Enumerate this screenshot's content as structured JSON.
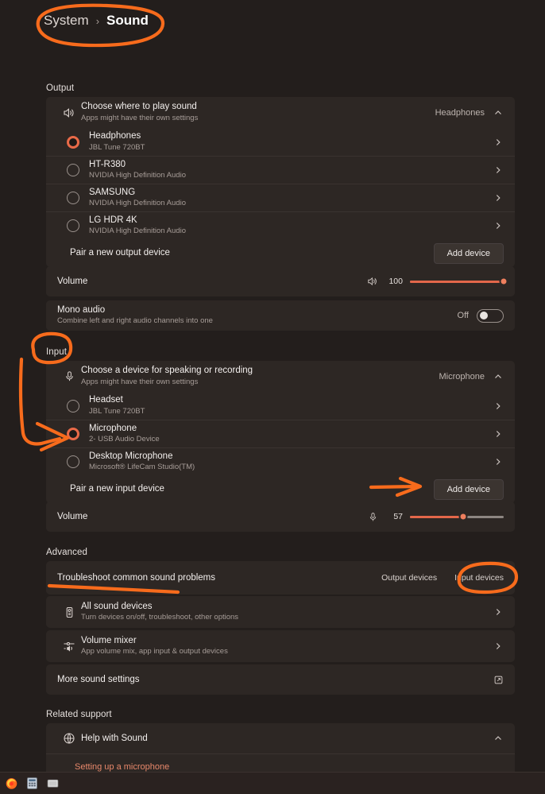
{
  "breadcrumb": {
    "parent": "System",
    "separator": "›",
    "current": "Sound"
  },
  "colors": {
    "page_background": "#231e1c",
    "card_background": "#2d2724",
    "accent": "#e3674a",
    "annotation": "#f76b1c",
    "text_primary": "#f3efed",
    "text_secondary": "#a79d98"
  },
  "output": {
    "label": "Output",
    "chooser": {
      "icon": "speaker-icon",
      "title": "Choose where to play sound",
      "subtitle": "Apps might have their own settings",
      "value": "Headphones",
      "expand_icon": "chevron-up-icon"
    },
    "devices": [
      {
        "name": "Headphones",
        "detail": "JBL Tune 720BT",
        "selected": true
      },
      {
        "name": "HT-R380",
        "detail": "NVIDIA High Definition Audio",
        "selected": false
      },
      {
        "name": "SAMSUNG",
        "detail": "NVIDIA High Definition Audio",
        "selected": false
      },
      {
        "name": "LG HDR 4K",
        "detail": "NVIDIA High Definition Audio",
        "selected": false
      }
    ],
    "pair": {
      "label": "Pair a new output device",
      "button": "Add device"
    },
    "volume": {
      "label": "Volume",
      "icon": "speaker-icon",
      "value": "100",
      "percent": 100
    },
    "mono": {
      "title": "Mono audio",
      "subtitle": "Combine left and right audio channels into one",
      "state": "Off"
    }
  },
  "input": {
    "label": "Input",
    "chooser": {
      "icon": "microphone-icon",
      "title": "Choose a device for speaking or recording",
      "subtitle": "Apps might have their own settings",
      "value": "Microphone",
      "expand_icon": "chevron-up-icon"
    },
    "devices": [
      {
        "name": "Headset",
        "detail": "JBL Tune 720BT",
        "selected": false
      },
      {
        "name": "Microphone",
        "detail": "2- USB Audio Device",
        "selected": true
      },
      {
        "name": "Desktop Microphone",
        "detail": "Microsoft® LifeCam Studio(TM)",
        "selected": false
      }
    ],
    "pair": {
      "label": "Pair a new input device",
      "button": "Add device"
    },
    "volume": {
      "label": "Volume",
      "icon": "microphone-icon",
      "value": "57",
      "percent": 57
    }
  },
  "advanced": {
    "label": "Advanced",
    "troubleshoot": {
      "title": "Troubleshoot common sound problems",
      "output_link": "Output devices",
      "input_link": "Input devices"
    },
    "all_devices": {
      "icon": "sound-devices-icon",
      "title": "All sound devices",
      "subtitle": "Turn devices on/off, troubleshoot, other options"
    },
    "volume_mixer": {
      "icon": "mixer-icon",
      "title": "Volume mixer",
      "subtitle": "App volume mix, app input & output devices"
    },
    "more": {
      "title": "More sound settings",
      "icon": "external-link-icon"
    }
  },
  "related_support": {
    "label": "Related support",
    "help": {
      "icon": "globe-help-icon",
      "title": "Help with Sound",
      "expand_icon": "chevron-up-icon"
    },
    "links": [
      "Setting up a microphone"
    ]
  },
  "taskbar": {
    "items": [
      {
        "icon": "firefox-icon"
      },
      {
        "icon": "calculator-icon"
      },
      {
        "icon": "window-icon"
      }
    ]
  },
  "annotations": [
    {
      "name": "breadcrumb-circle",
      "shape": "ellipse"
    },
    {
      "name": "input-label-circle",
      "shape": "ellipse"
    },
    {
      "name": "microphone-arrow",
      "shape": "arrow"
    },
    {
      "name": "add-device-arrow",
      "shape": "arrow"
    },
    {
      "name": "troubleshoot-underline",
      "shape": "line"
    },
    {
      "name": "input-devices-circle",
      "shape": "ellipse"
    }
  ]
}
